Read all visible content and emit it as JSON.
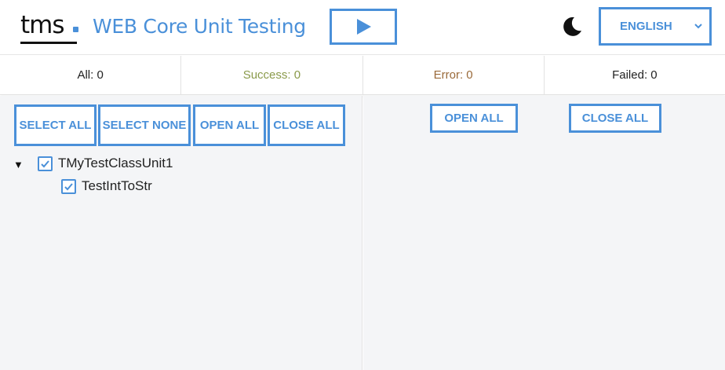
{
  "header": {
    "logo_text": "tms",
    "title": "WEB Core Unit Testing",
    "run_icon": "play-icon",
    "theme_icon": "moon-icon",
    "language": "ENGLISH",
    "accent_color": "#4a90d9"
  },
  "stats": {
    "all": "All: 0",
    "success": "Success: 0",
    "error": "Error: 0",
    "failed": "Failed: 0"
  },
  "left_toolbar": {
    "select_all": "SELECT ALL",
    "select_none": "SELECT NONE",
    "open_all": "OPEN ALL",
    "close_all": "CLOSE ALL"
  },
  "tree": {
    "root": {
      "label": "TMyTestClassUnit1",
      "checked": true,
      "expanded": true,
      "toggle_glyph": "▼"
    },
    "children": [
      {
        "label": "TestIntToStr",
        "checked": true
      }
    ]
  },
  "right_toolbar": {
    "open_all": "OPEN ALL",
    "close_all": "CLOSE ALL"
  }
}
